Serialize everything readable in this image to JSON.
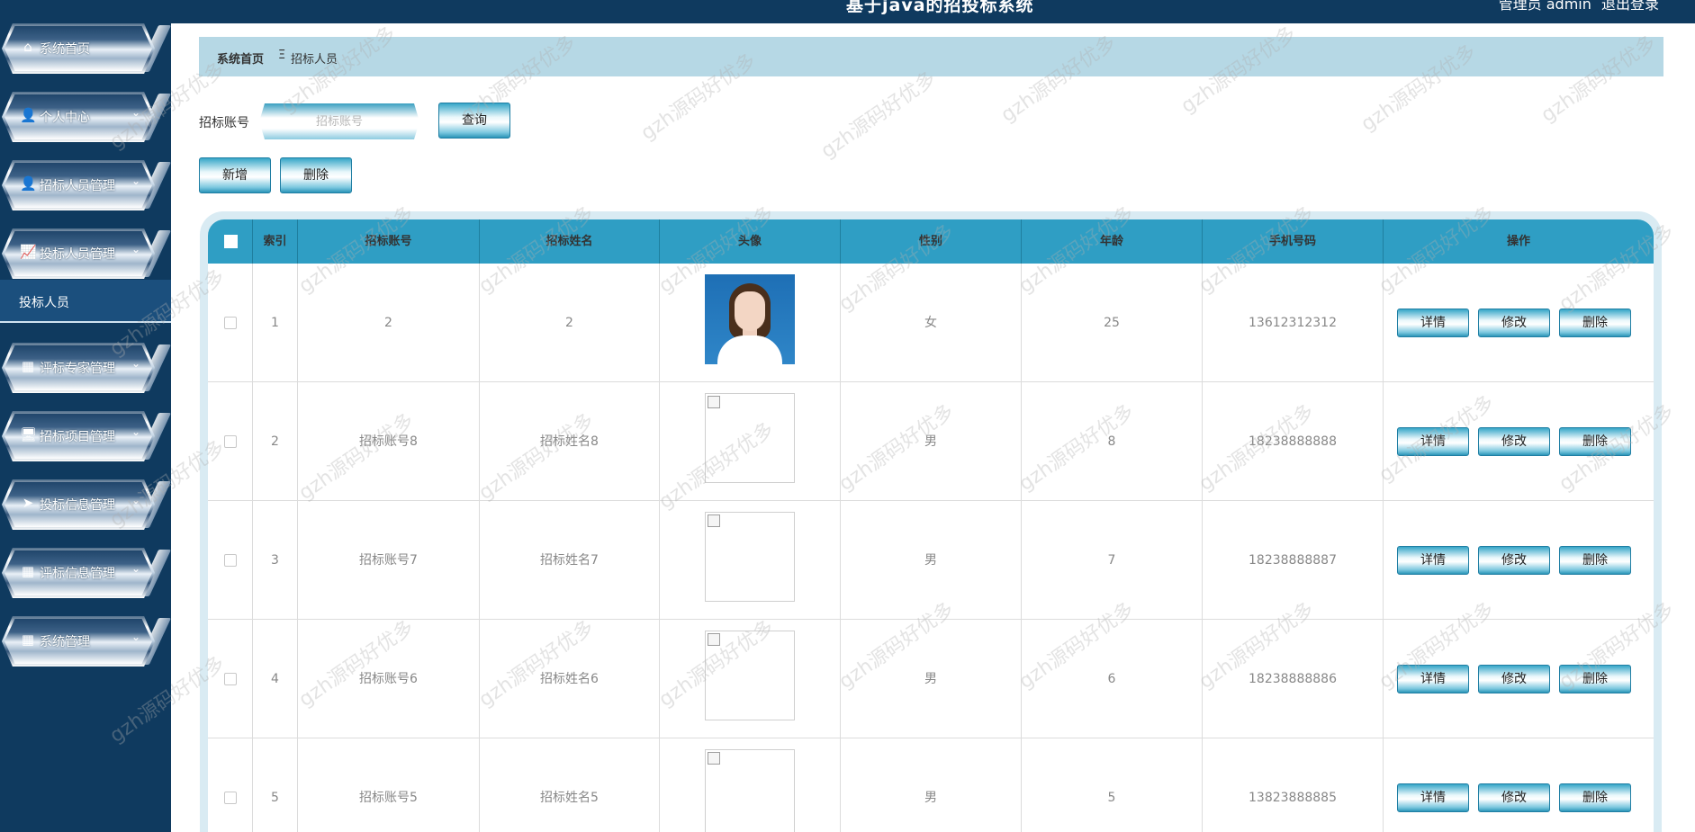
{
  "header": {
    "title": "基于java的招投标系统",
    "user_text": "管理员 admin",
    "logout_label": "退出登录"
  },
  "sidebar": {
    "items": [
      {
        "label": "系统首页",
        "icon": "home-icon",
        "glyph": "⌂",
        "has_children": false
      },
      {
        "label": "个人中心",
        "icon": "user-icon",
        "glyph": "👤",
        "has_children": true
      },
      {
        "label": "招标人员管理",
        "icon": "user-icon",
        "glyph": "👤",
        "has_children": true
      },
      {
        "label": "投标人员管理",
        "icon": "chart-icon",
        "glyph": "📈",
        "has_children": true
      },
      {
        "label": "评标专家管理",
        "icon": "grid-icon",
        "glyph": "▦",
        "has_children": true
      },
      {
        "label": "招标项目管理",
        "icon": "monitor-icon",
        "glyph": "🖥",
        "has_children": true
      },
      {
        "label": "投标信息管理",
        "icon": "send-icon",
        "glyph": "➤",
        "has_children": true
      },
      {
        "label": "评标信息管理",
        "icon": "grid-icon",
        "glyph": "▦",
        "has_children": true
      },
      {
        "label": "系统管理",
        "icon": "grid-icon",
        "glyph": "▦",
        "has_children": true
      }
    ],
    "submenu": {
      "label": "投标人员"
    },
    "chevron": "⌄"
  },
  "breadcrumb": {
    "home": "系统首页",
    "separator": "Ξ",
    "current": "招标人员"
  },
  "search": {
    "label": "招标账号",
    "placeholder": "招标账号",
    "value": "",
    "button_label": "查询"
  },
  "toolbar": {
    "add_label": "新增",
    "delete_label": "删除"
  },
  "table": {
    "columns": [
      "",
      "索引",
      "招标账号",
      "招标姓名",
      "头像",
      "性别",
      "年龄",
      "手机号码",
      "操作"
    ],
    "rows": [
      {
        "index": "1",
        "account": "2",
        "name": "2",
        "avatar": "photo",
        "gender": "女",
        "age": "25",
        "phone": "13612312312"
      },
      {
        "index": "2",
        "account": "招标账号8",
        "name": "招标姓名8",
        "avatar": "broken",
        "gender": "男",
        "age": "8",
        "phone": "18238888888"
      },
      {
        "index": "3",
        "account": "招标账号7",
        "name": "招标姓名7",
        "avatar": "broken",
        "gender": "男",
        "age": "7",
        "phone": "18238888887"
      },
      {
        "index": "4",
        "account": "招标账号6",
        "name": "招标姓名6",
        "avatar": "broken",
        "gender": "男",
        "age": "6",
        "phone": "18238888886"
      },
      {
        "index": "5",
        "account": "招标账号5",
        "name": "招标姓名5",
        "avatar": "broken",
        "gender": "男",
        "age": "5",
        "phone": "13823888885"
      }
    ],
    "actions": [
      "详情",
      "修改",
      "删除"
    ]
  },
  "watermark": "gzh源码好优多",
  "colors": {
    "sidebar_bg": "#0f3a5f",
    "breadcrumb_bg": "#b6d8e5",
    "table_header_bg": "#2f9ec4",
    "submenu_bg": "#1b4f7d"
  }
}
